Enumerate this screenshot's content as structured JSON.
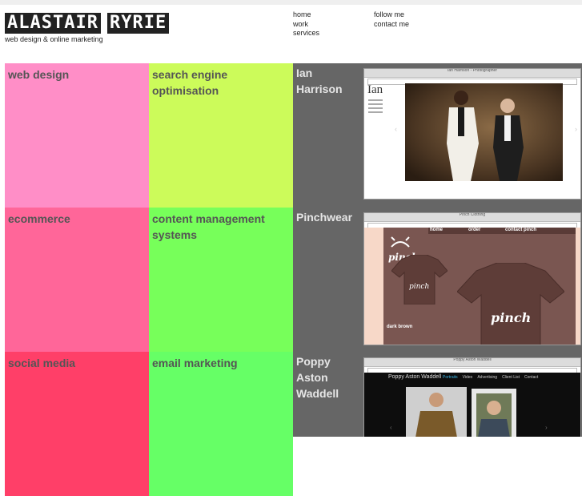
{
  "header": {
    "logo_word_1": "ALASTAIR",
    "logo_word_2": "RYRIE",
    "tagline": "web design & online marketing"
  },
  "nav": {
    "col1": [
      "home",
      "work",
      "services"
    ],
    "col2": [
      "follow me",
      "contact me"
    ]
  },
  "services": [
    {
      "title": "web design",
      "color": "#ff8ec7"
    },
    {
      "title": "search engine optimisation",
      "color": "#ccfb5a"
    },
    {
      "title": "ecommerce",
      "color": "#ff6699"
    },
    {
      "title": "content management systems",
      "color": "#77ff5a"
    },
    {
      "title": "social media",
      "color": "#ff3f68"
    },
    {
      "title": "email marketing",
      "color": "#66ff66"
    }
  ],
  "projects": [
    {
      "title": "Ian Harrison",
      "icon": "photographer-site-screenshot",
      "shot_bar": "Ian Harrison - Photographer",
      "shot_logo": "Ian"
    },
    {
      "title": "Pinchwear",
      "icon": "tshirt-store-screenshot",
      "shot_bar": "Pinch Clothing",
      "shot_nav": [
        "home",
        "order",
        "contact pinch"
      ],
      "shot_brand": "pinch",
      "shot_caption": "dark brown"
    },
    {
      "title": "Poppy Aston Waddell",
      "icon": "portfolio-site-screenshot",
      "shot_bar": "Poppy Aston Waddell",
      "shot_logo": "Poppy Aston Waddell",
      "shot_nav": [
        "Portraits",
        "Video",
        "Advertising",
        "Client List",
        "Contact"
      ]
    }
  ],
  "colors": {
    "grid_bg": "#666666",
    "logo_bg": "#222222"
  }
}
